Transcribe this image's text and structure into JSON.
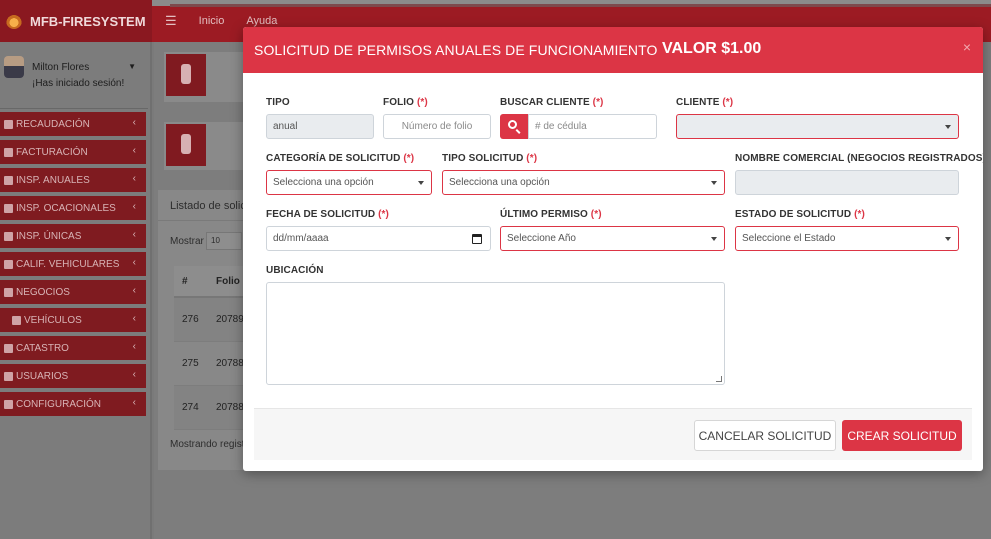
{
  "app": {
    "brand": "MFB-FIRESYSTEM"
  },
  "topnav": {
    "menu_icon": "☰",
    "items": [
      "Inicio",
      "Ayuda"
    ]
  },
  "user": {
    "name": "Milton Flores",
    "status": "¡Has iniciado sesión!"
  },
  "sidebar": {
    "items": [
      {
        "label": "RECAUDACIÓN",
        "icon": "dollar-icon"
      },
      {
        "label": "FACTURACIÓN",
        "icon": "invoice-icon"
      },
      {
        "label": "INSP. ANUALES",
        "icon": "extinguisher-icon"
      },
      {
        "label": "INSP. OCACIONALES",
        "icon": "extinguisher-icon"
      },
      {
        "label": "INSP. ÚNICAS",
        "icon": "extinguisher-icon"
      },
      {
        "label": "CALIF. VEHICULARES",
        "icon": "car-icon"
      },
      {
        "label": "NEGOCIOS",
        "icon": "building-icon"
      },
      {
        "label": "VEHÍCULOS",
        "icon": "car-icon"
      },
      {
        "label": "CATASTRO",
        "icon": "copy-icon"
      },
      {
        "label": "USUARIOS",
        "icon": "user-plus-icon"
      },
      {
        "label": "CONFIGURACIÓN",
        "icon": "gear-icon"
      }
    ]
  },
  "background_panel": {
    "title": "Listado de solic",
    "show_label": "Mostrar",
    "show_value": "10",
    "headers": [
      "#",
      "Folio"
    ],
    "rows": [
      {
        "id": "276",
        "folio": "20789"
      },
      {
        "id": "275",
        "folio": "20788"
      },
      {
        "id": "274",
        "folio": "20788"
      }
    ],
    "footer": "Mostrando regist"
  },
  "modal": {
    "title": "SOLICITUD DE PERMISOS ANUALES DE FUNCIONAMIENTO",
    "valor": "VALOR $1.00",
    "close": "×",
    "required_mark": "(*)",
    "fields": {
      "tipo": {
        "label": "TIPO",
        "value": "anual"
      },
      "folio": {
        "label": "FOLIO",
        "placeholder": "Número de folio"
      },
      "buscar_cliente": {
        "label": "BUSCAR CLIENTE",
        "placeholder": "# de cédula"
      },
      "cliente": {
        "label": "CLIENTE",
        "value": ""
      },
      "categoria": {
        "label": "CATEGORÍA DE SOLICITUD",
        "value": "Selecciona una opción"
      },
      "tipo_solicitud": {
        "label": "TIPO SOLICITUD",
        "value": "Selecciona una opción"
      },
      "nombre_comercial": {
        "label": "NOMBRE COMERCIAL (NEGOCIOS REGISTRADOS)",
        "value": ""
      },
      "fecha": {
        "label": "FECHA DE SOLICITUD",
        "placeholder": "dd/mm/aaaa"
      },
      "ultimo_permiso": {
        "label": "ÚLTIMO PERMISO",
        "value": "Seleccione Año"
      },
      "estado": {
        "label": "ESTADO DE SOLICITUD",
        "value": "Seleccione el Estado"
      },
      "ubicacion": {
        "label": "UBICACIÓN"
      }
    },
    "buttons": {
      "cancel": "CANCELAR SOLICITUD",
      "create": "CREAR SOLICITUD"
    }
  },
  "colors": {
    "primary": "#dc3545",
    "topbar": "#9c1b23",
    "sidebar_item": "#7f1b20"
  }
}
